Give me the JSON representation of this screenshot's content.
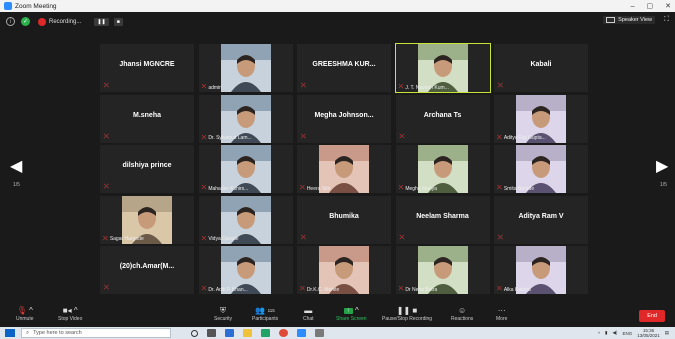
{
  "window": {
    "title": "Zoom Meeting",
    "minimize": "–",
    "restore": "▢",
    "close": "✕"
  },
  "topbar": {
    "recording_label": "Recording...",
    "pause": "❚❚",
    "stop": "■",
    "view_label": "Speaker View",
    "fullscreen": "⛶"
  },
  "navigation": {
    "left_page": "1/5",
    "right_page": "1/5",
    "prev": "◀",
    "next": "▶"
  },
  "participants": [
    {
      "name": "Jhansi MGNCRE",
      "video": false
    },
    {
      "name": "admin",
      "video": true
    },
    {
      "name": "GREESHMA KUR...",
      "video": false
    },
    {
      "name": "J. T. Naveen Kum...",
      "video": true,
      "active": true
    },
    {
      "name": "Kabali",
      "video": false
    },
    {
      "name": "M.sneha",
      "video": false
    },
    {
      "name": "Dr. Sylvanus Lam...",
      "video": true
    },
    {
      "name": "Megha Johnson...",
      "video": false
    },
    {
      "name": "Archana Ts",
      "video": false
    },
    {
      "name": "Aditya Raj Gupta...",
      "video": true
    },
    {
      "name": "dilshiya prince",
      "video": false
    },
    {
      "name": "Mahadev Kshirs...",
      "video": true
    },
    {
      "name": "Heera Sibi",
      "video": true
    },
    {
      "name": "Megha Mariya",
      "video": true
    },
    {
      "name": "Smita Borade",
      "video": true
    },
    {
      "name": "Sagar Hargode",
      "video": true
    },
    {
      "name": "Vidya Darade",
      "video": true
    },
    {
      "name": "Bhumika",
      "video": false
    },
    {
      "name": "Neelam Sharma",
      "video": false
    },
    {
      "name": "Aditya Ram V",
      "video": false
    },
    {
      "name": "(20)ch.Amar(M...",
      "video": false
    },
    {
      "name": "Dr. Aditi R Khan...",
      "video": true
    },
    {
      "name": "Dr.K.C. Mohite",
      "video": true
    },
    {
      "name": "Dr Neha Batra",
      "video": true
    },
    {
      "name": "Alka Kataria",
      "video": true
    }
  ],
  "toolbar": {
    "unmute": "Unmute",
    "stop_video": "Stop Video",
    "security": "Security",
    "participants": "Participants",
    "participants_count": "115",
    "chat": "Chat",
    "share_screen": "Share Screen",
    "pause_recording": "Pause/Stop Recording",
    "reactions": "Reactions",
    "more": "More",
    "end": "End"
  },
  "taskbar": {
    "search_placeholder": "Type here to search",
    "lang": "ENG",
    "time": "15:36",
    "date": "13/05/2021"
  },
  "colors": {
    "mute": "#e23b3b",
    "share": "#24a348",
    "end": "#e02828",
    "active_border": "#c6e33a"
  }
}
